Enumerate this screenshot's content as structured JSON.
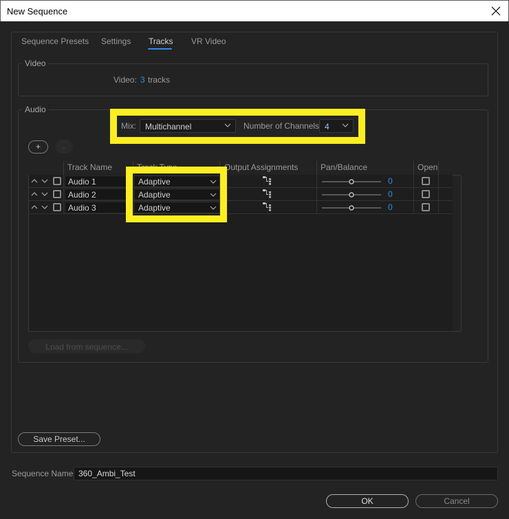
{
  "window": {
    "title": "New Sequence",
    "close_icon": "close-icon"
  },
  "tabs": [
    {
      "label": "Sequence Presets",
      "active": false
    },
    {
      "label": "Settings",
      "active": false
    },
    {
      "label": "Tracks",
      "active": true
    },
    {
      "label": "VR Video",
      "active": false
    }
  ],
  "video": {
    "group_label": "Video",
    "label": "Video:",
    "count": "3",
    "unit": "tracks"
  },
  "audio": {
    "group_label": "Audio",
    "mix_label": "Mix:",
    "mix_value": "Multichannel",
    "channels_label": "Number of Channels:",
    "channels_value": "4",
    "add_button": "+",
    "remove_button": "-",
    "columns": [
      "Track Name",
      "Track Type",
      "Output Assignments",
      "Pan/Balance",
      "Open"
    ],
    "tracks": [
      {
        "name": "Audio 1",
        "type": "Adaptive",
        "pan": "0",
        "pan_fraction": 0.5,
        "open": false,
        "selected": false
      },
      {
        "name": "Audio 2",
        "type": "Adaptive",
        "pan": "0",
        "pan_fraction": 0.5,
        "open": false,
        "selected": false
      },
      {
        "name": "Audio 3",
        "type": "Adaptive",
        "pan": "0",
        "pan_fraction": 0.5,
        "open": false,
        "selected": false
      }
    ],
    "load_button": "Load from sequence..."
  },
  "footer": {
    "save_preset": "Save Preset...",
    "sequence_name_label": "Sequence Name:",
    "sequence_name_value": "360_Ambi_Test",
    "ok": "OK",
    "cancel": "Cancel"
  },
  "colors": {
    "accent": "#2d8ceb",
    "highlight": "#fcee21",
    "background": "#232323"
  }
}
